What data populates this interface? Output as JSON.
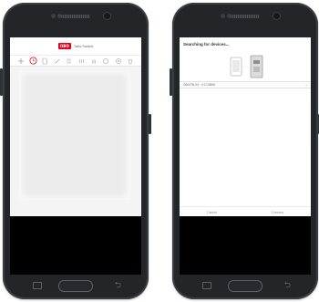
{
  "left_phone": {
    "app": {
      "logo": "OBO",
      "title": "Tabs Switch",
      "toolbar": [
        {
          "name": "add-icon",
          "glyph": "+"
        },
        {
          "name": "circle-tool-icon",
          "active": true
        },
        {
          "name": "document-icon"
        },
        {
          "name": "pen-icon"
        },
        {
          "name": "ruler-icon"
        },
        {
          "name": "grid-icon"
        },
        {
          "name": "hand-icon"
        },
        {
          "name": "settings-icon"
        },
        {
          "name": "gear-icon"
        },
        {
          "name": "trash-icon"
        }
      ]
    }
  },
  "right_phone": {
    "app": {
      "title": "Searching for devices...",
      "device_name": "OBO/TB-XX · 0:17:0B6H",
      "row_arrow": "›",
      "buttons": {
        "cancel": "Cancel",
        "connect": "Connect"
      }
    }
  },
  "colors": {
    "brand_red": "#e2001a",
    "phone_body": "#232528"
  }
}
